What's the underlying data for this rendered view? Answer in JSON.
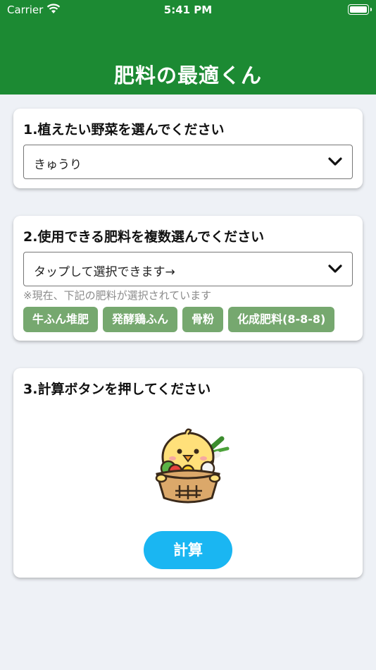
{
  "status_bar": {
    "carrier": "Carrier",
    "time": "5:41 PM"
  },
  "header": {
    "title": "肥料の最適くん"
  },
  "step1": {
    "title": "1.植えたい野菜を選んでください",
    "selected_value": "きゅうり"
  },
  "step2": {
    "title": "2.使用できる肥料を複数選んでください",
    "selected_value": "タップして選択できます→",
    "hint": "※現在、下記の肥料が選択されています",
    "chips": [
      "牛ふん堆肥",
      "発酵鶏ふん",
      "骨粉",
      "化成肥料(8-8-8)"
    ]
  },
  "step3": {
    "title": "3.計算ボタンを押してください",
    "button_label": "計算"
  },
  "colors": {
    "header_green": "#1c8a33",
    "chip_green": "#76a86f",
    "button_blue": "#1ab6f2",
    "background": "#eef1f6"
  },
  "icons": [
    "wifi-icon",
    "battery-icon",
    "chevron-down-icon",
    "chick-mascot-illustration"
  ]
}
